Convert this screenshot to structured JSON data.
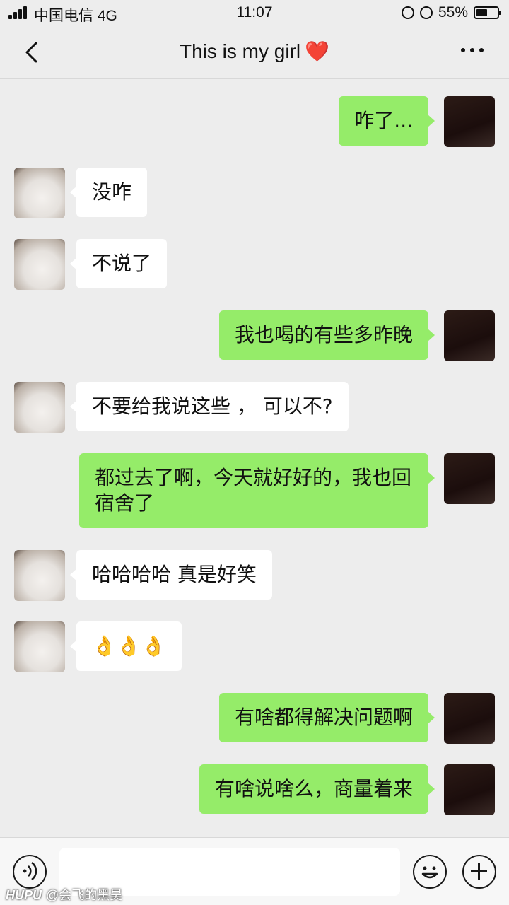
{
  "status_bar": {
    "carrier": "中国电信 4G",
    "time": "11:07",
    "battery": "55%",
    "battery_level": 0.55,
    "icons": [
      "signal-icon",
      "alarm-icon",
      "rotation-lock-icon",
      "battery-icon"
    ]
  },
  "header": {
    "title": "This is my girl",
    "title_emoji": "❤️",
    "icons": [
      "back-arrow-icon",
      "more-icon"
    ]
  },
  "messages": [
    {
      "sender": "me",
      "text": "咋了..."
    },
    {
      "sender": "her",
      "text": "没咋"
    },
    {
      "sender": "her",
      "text": "不说了"
    },
    {
      "sender": "me",
      "text": "我也喝的有些多昨晚"
    },
    {
      "sender": "her",
      "text": "不要给我说这些 ， 可以不?"
    },
    {
      "sender": "me",
      "text": "都过去了啊，今天就好好的，我也回宿舍了"
    },
    {
      "sender": "her",
      "text": "哈哈哈哈 真是好笑"
    },
    {
      "sender": "her",
      "text": "👌👌👌"
    },
    {
      "sender": "me",
      "text": "有啥都得解决问题啊"
    },
    {
      "sender": "me",
      "text": "有啥说啥么，商量着来"
    }
  ],
  "input_bar": {
    "value": "",
    "icons": [
      "voice-icon",
      "emoji-icon",
      "plus-icon"
    ]
  },
  "watermark": {
    "brand": "HUPU",
    "text": "@会飞的黑昊"
  },
  "colors": {
    "my_bubble": "#95ec69",
    "her_bubble": "#ffffff",
    "background": "#ededed"
  }
}
